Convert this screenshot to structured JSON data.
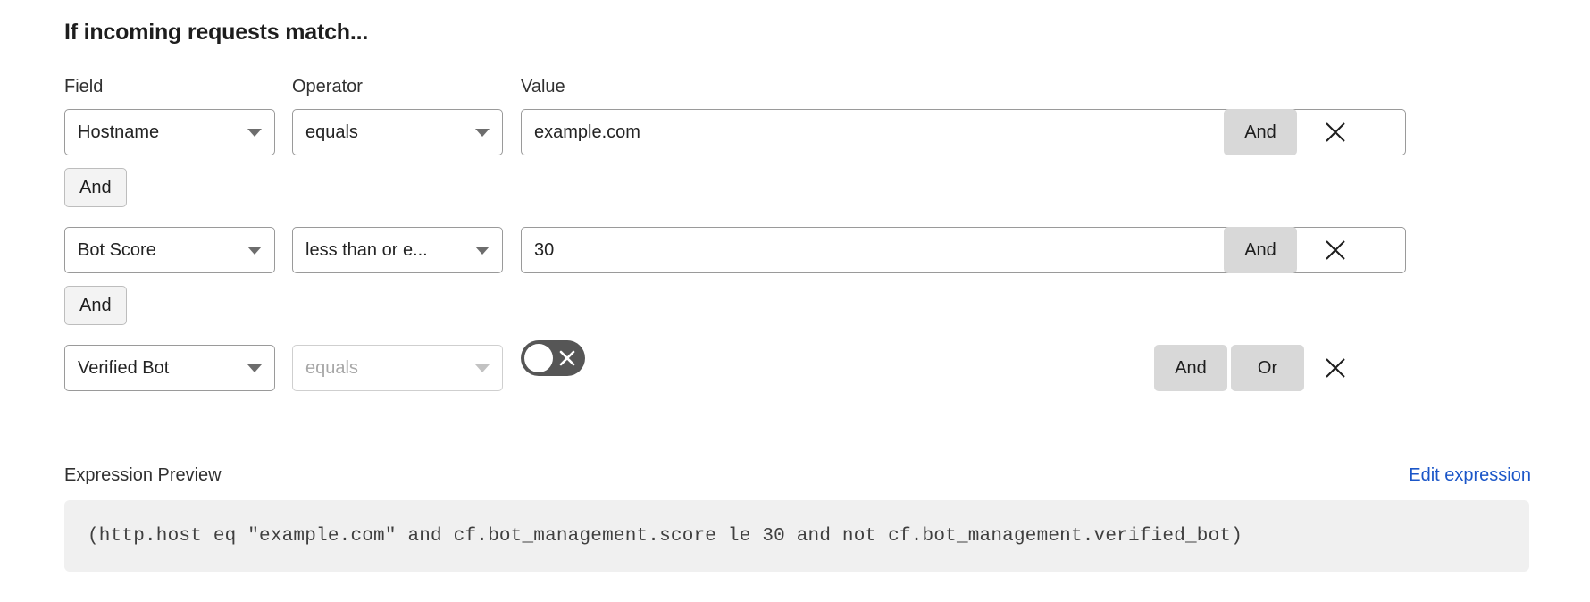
{
  "heading": "If incoming requests match...",
  "columns": {
    "field": "Field",
    "operator": "Operator",
    "value": "Value"
  },
  "rows": [
    {
      "field": "Hostname",
      "operator": "equals",
      "value": "example.com",
      "logic_and": "And",
      "close": "close-icon"
    },
    {
      "field": "Bot Score",
      "operator": "less than or e...",
      "value": "30",
      "logic_and": "And",
      "close": "close-icon"
    },
    {
      "field": "Verified Bot",
      "operator_placeholder": "equals",
      "toggle_state": "off",
      "logic_and": "And",
      "logic_or": "Or",
      "close": "close-icon"
    }
  ],
  "connectors": [
    {
      "label": "And"
    },
    {
      "label": "And"
    }
  ],
  "preview": {
    "label": "Expression Preview",
    "edit_link": "Edit expression",
    "expression": "(http.host eq \"example.com\" and cf.bot_management.score le 30 and not cf.bot_management.verified_bot)"
  },
  "colors": {
    "link": "#1b56c8",
    "logic_button_bg": "#d8d8d8",
    "connector_chip_bg": "#f3f3f3",
    "preview_bg": "#f0f0f0",
    "toggle_off_bg": "#565656"
  }
}
